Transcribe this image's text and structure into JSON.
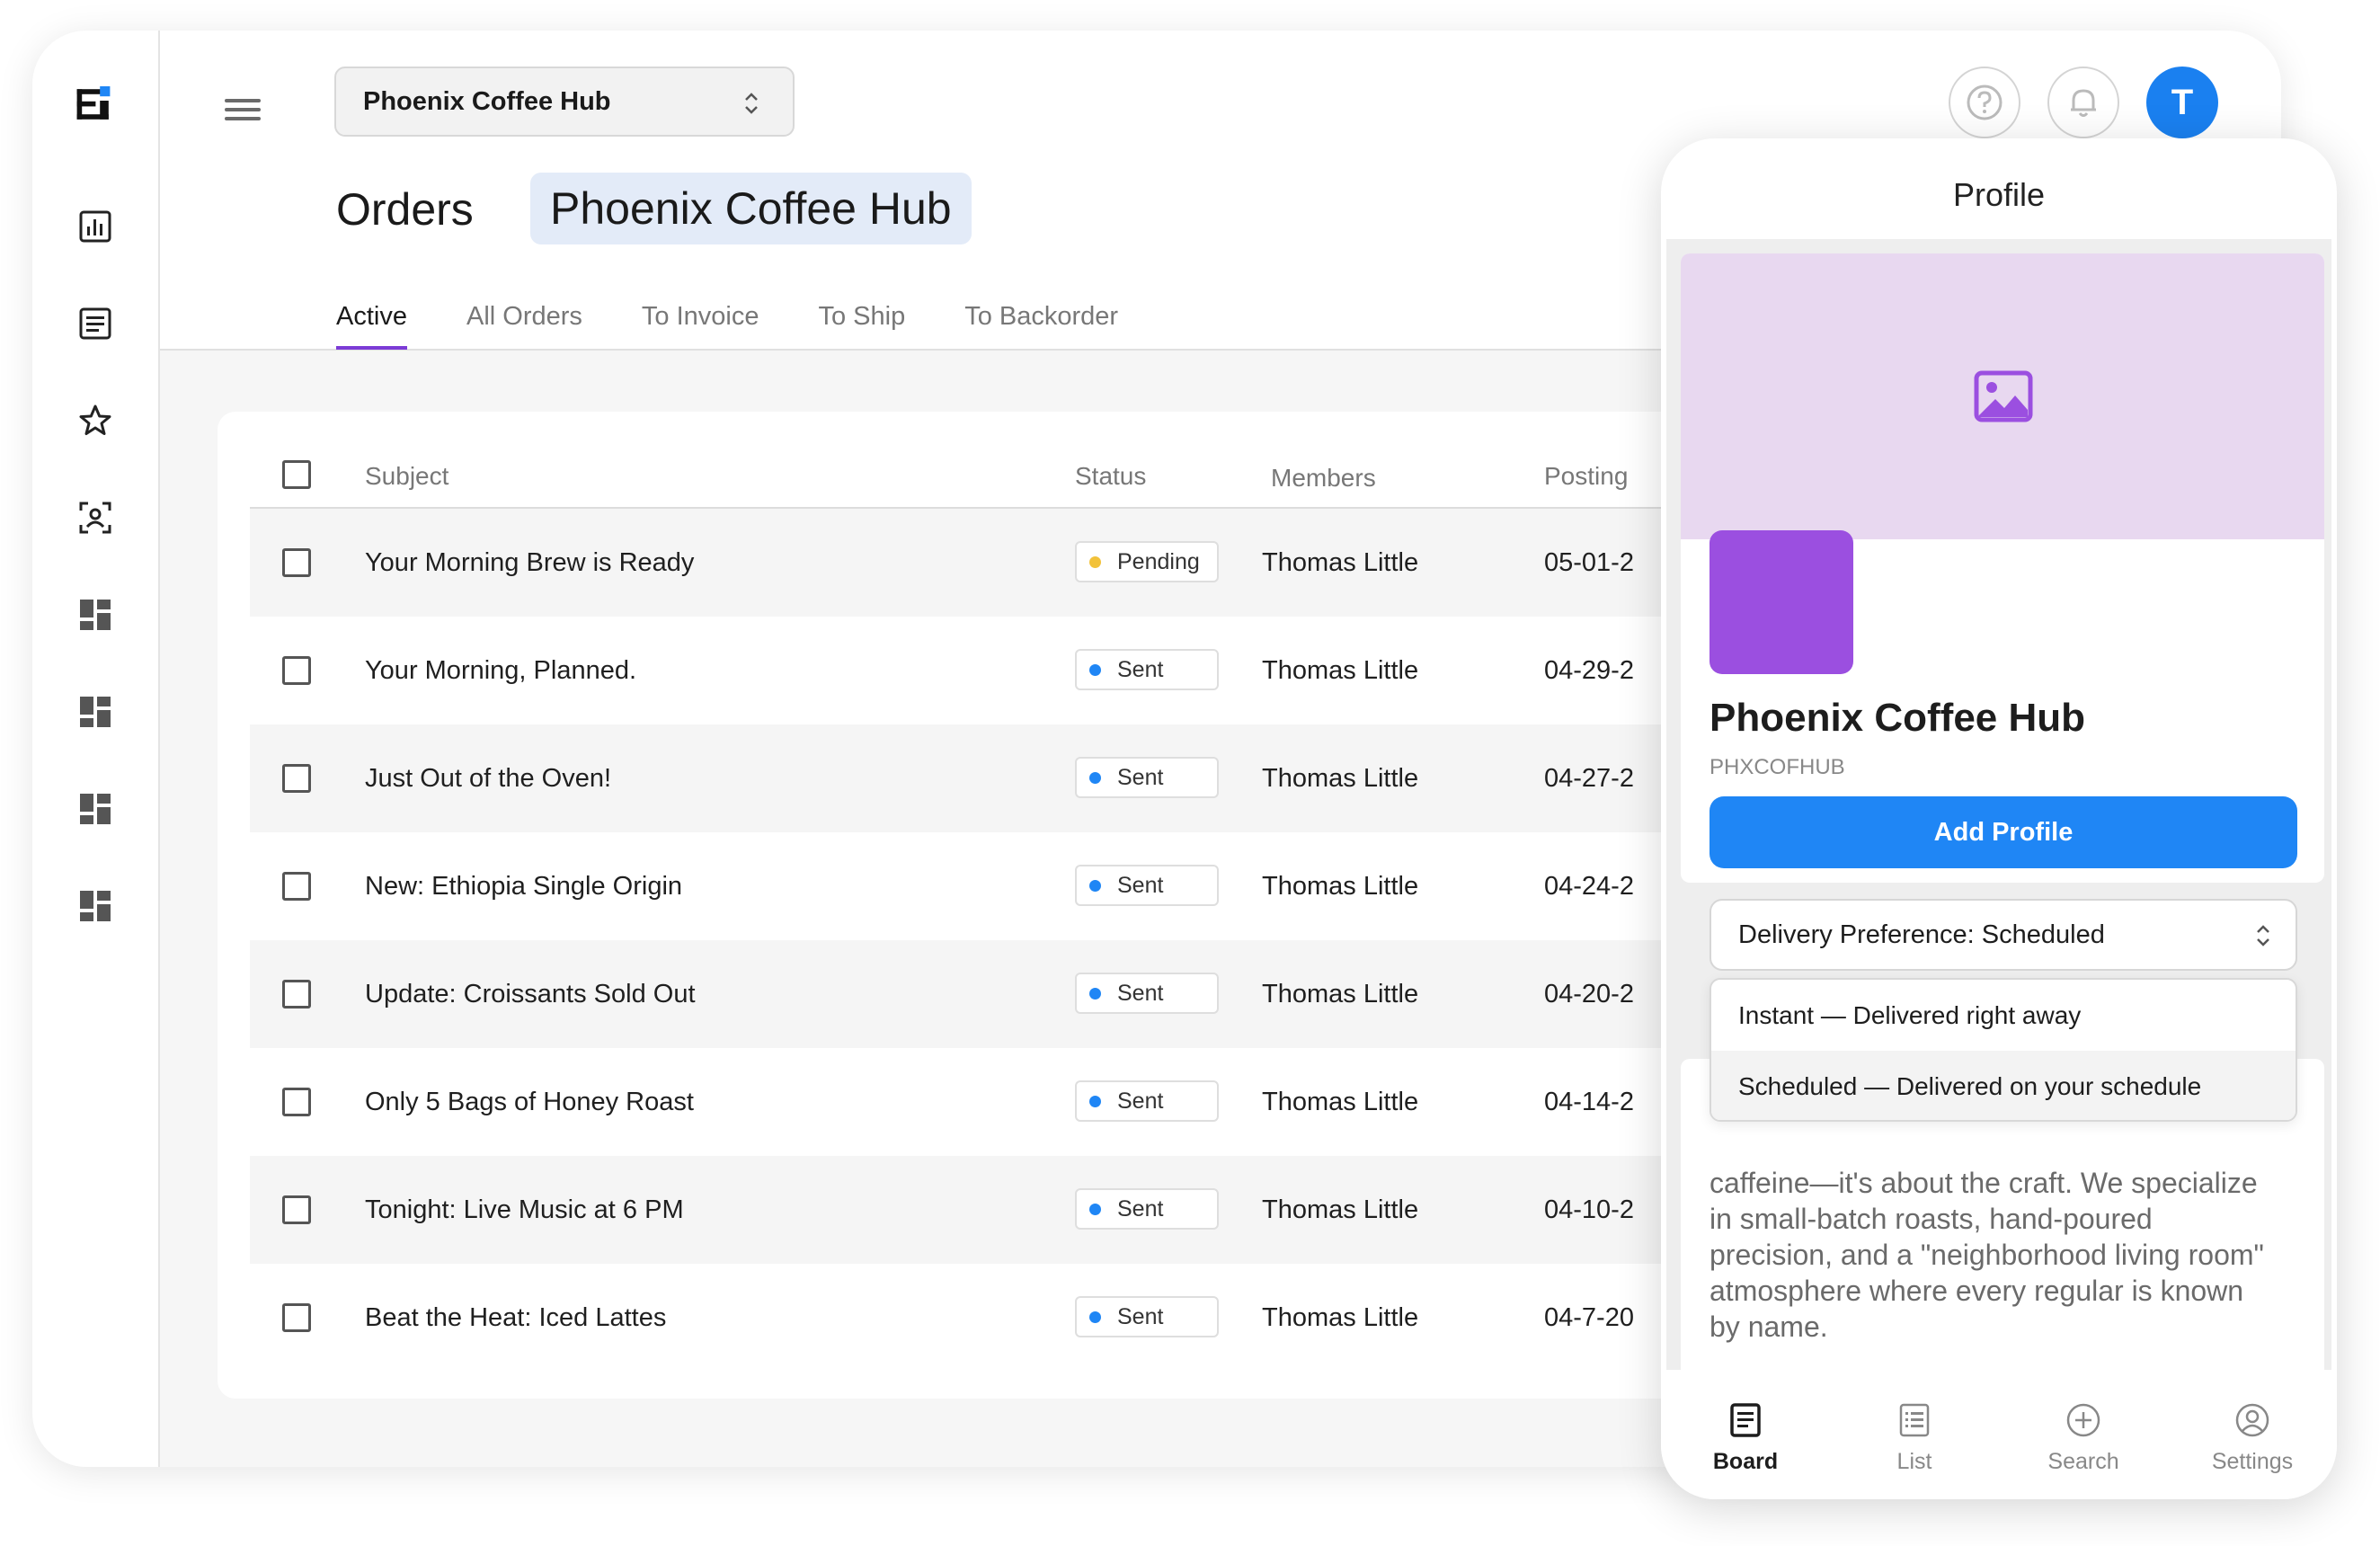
{
  "header": {
    "org_selector": "Phoenix Coffee Hub",
    "page_title": "Orders",
    "title_pill": "Phoenix Coffee Hub",
    "avatar_letter": "T"
  },
  "tabs": [
    {
      "label": "Active",
      "active": true
    },
    {
      "label": "All Orders"
    },
    {
      "label": "To Invoice"
    },
    {
      "label": "To Ship"
    },
    {
      "label": "To Backorder"
    }
  ],
  "table": {
    "columns": [
      "Subject",
      "Status",
      "Members",
      "Posting"
    ],
    "rows": [
      {
        "subject": "Your Morning Brew is Ready",
        "status": "Pending",
        "status_color": "#f2c23a",
        "member": "Thomas Little",
        "posting": "05-01-2"
      },
      {
        "subject": "Your Morning, Planned.",
        "status": "Sent",
        "status_color": "#1f86f5",
        "member": "Thomas Little",
        "posting": "04-29-2"
      },
      {
        "subject": "Just Out of the Oven!",
        "status": "Sent",
        "status_color": "#1f86f5",
        "member": "Thomas Little",
        "posting": "04-27-2"
      },
      {
        "subject": "New: Ethiopia Single Origin",
        "status": "Sent",
        "status_color": "#1f86f5",
        "member": "Thomas Little",
        "posting": "04-24-2"
      },
      {
        "subject": "Update: Croissants Sold Out",
        "status": "Sent",
        "status_color": "#1f86f5",
        "member": "Thomas Little",
        "posting": "04-20-2"
      },
      {
        "subject": "Only 5 Bags of Honey Roast",
        "status": "Sent",
        "status_color": "#1f86f5",
        "member": "Thomas Little",
        "posting": "04-14-2"
      },
      {
        "subject": "Tonight: Live Music at 6 PM",
        "status": "Sent",
        "status_color": "#1f86f5",
        "member": "Thomas Little",
        "posting": "04-10-2"
      },
      {
        "subject": "Beat the Heat: Iced Lattes",
        "status": "Sent",
        "status_color": "#1f86f5",
        "member": "Thomas Little",
        "posting": "04-7-20"
      }
    ]
  },
  "profile": {
    "title": "Profile",
    "org_name": "Phoenix Coffee Hub",
    "org_code": "PHXCOFHUB",
    "add_button": "Add Profile",
    "preference_select": "Delivery Preference: Scheduled",
    "preference_options": [
      {
        "label": "Instant — Delivered right away"
      },
      {
        "label": "Scheduled — Delivered on your schedule",
        "selected": true
      }
    ],
    "description": "caffeine—it's about the craft. We specialize in small-batch roasts, hand-poured precision, and a \"neighborhood living room\" atmosphere where every regular is known by name.",
    "bottom_nav": [
      {
        "label": "Board",
        "icon": "board-icon",
        "active": true
      },
      {
        "label": "List",
        "icon": "list-icon"
      },
      {
        "label": "Search",
        "icon": "plus-circle-icon"
      },
      {
        "label": "Settings",
        "icon": "user-circle-icon"
      }
    ]
  },
  "colors": {
    "accent": "#7c3bd6",
    "primary_button": "#1f86f5",
    "cover": "#e8d8f0",
    "logo": "#9b4fe0"
  }
}
